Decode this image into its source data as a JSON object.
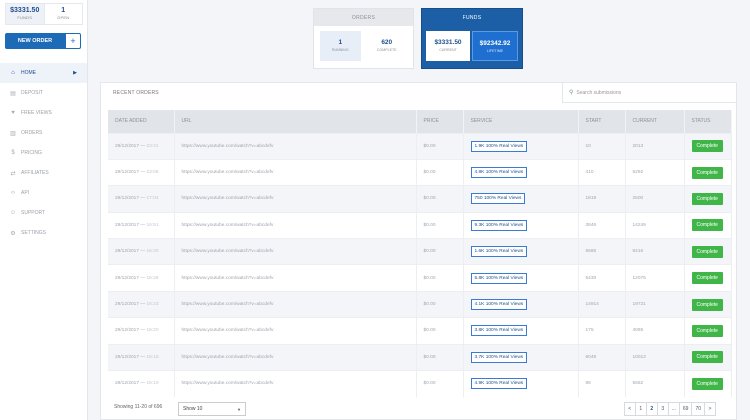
{
  "sidebar": {
    "stats": {
      "funds_value": "$3331.50",
      "funds_label": "FUNDS",
      "open_value": "1",
      "open_label": "OPEN"
    },
    "new_order_label": "NEW ORDER",
    "new_order_plus": "+",
    "items": [
      {
        "label": "HOME",
        "icon": "home-icon"
      },
      {
        "label": "DEPOSIT",
        "icon": "wallet-icon"
      },
      {
        "label": "FREE VIEWS",
        "icon": "heart-icon"
      },
      {
        "label": "ORDERS",
        "icon": "document-icon"
      },
      {
        "label": "PRICING",
        "icon": "dollar-icon"
      },
      {
        "label": "AFFILIATES",
        "icon": "share-icon"
      },
      {
        "label": "API",
        "icon": "code-icon"
      },
      {
        "label": "SUPPORT",
        "icon": "users-icon"
      },
      {
        "label": "SETTINGS",
        "icon": "gear-icon"
      }
    ]
  },
  "orders_card": {
    "title": "ORDERS",
    "running_value": "1",
    "running_label": "RUNNING",
    "complete_value": "620",
    "complete_label": "COMPLETE"
  },
  "funds_card": {
    "title": "FUNDS",
    "current_value": "$3331.50",
    "current_label": "CURRENT",
    "lifetime_value": "$92342.92",
    "lifetime_label": "LIFETIME"
  },
  "recent": {
    "title": "RECENT ORDERS",
    "search_placeholder": "Search submissions",
    "columns": [
      "DATE ADDED",
      "URL",
      "PRICE",
      "SERVICE",
      "START",
      "CURRENT",
      "STATUS"
    ],
    "rows": [
      {
        "date": "29/12/2017",
        "time": "23:41",
        "url": "https://www.youtube.com/watch?v=abcdefv",
        "price": "$0.00",
        "service": "1.9K 100% Real Views",
        "start": "10",
        "current": "2013",
        "status": "Complete"
      },
      {
        "date": "29/12/2017",
        "time": "23:08",
        "url": "https://www.youtube.com/watch?v=abcdefv",
        "price": "$0.00",
        "service": "4.8K 100% Real Views",
        "start": "410",
        "current": "5292",
        "status": "Complete"
      },
      {
        "date": "29/12/2017",
        "time": "17:04",
        "url": "https://www.youtube.com/watch?v=abcdefv",
        "price": "$0.00",
        "service": "750 100% Real Views",
        "start": "1819",
        "current": "2500",
        "status": "Complete"
      },
      {
        "date": "29/12/2017",
        "time": "16:51",
        "url": "https://www.youtube.com/watch?v=abcdefv",
        "price": "$0.00",
        "service": "9.3K 100% Real Views",
        "start": "3846",
        "current": "14249",
        "status": "Complete"
      },
      {
        "date": "29/12/2017",
        "time": "16:30",
        "url": "https://www.youtube.com/watch?v=abcdefv",
        "price": "$0.00",
        "service": "1.6K 100% Real Views",
        "start": "6586",
        "current": "8416",
        "status": "Complete"
      },
      {
        "date": "29/12/2017",
        "time": "16:26",
        "url": "https://www.youtube.com/watch?v=abcdefv",
        "price": "$0.00",
        "service": "5.8K 100% Real Views",
        "start": "5430",
        "current": "12075",
        "status": "Complete"
      },
      {
        "date": "29/12/2017",
        "time": "16:23",
        "url": "https://www.youtube.com/watch?v=abcdefv",
        "price": "$0.00",
        "service": "4.1K 100% Real Views",
        "start": "14914",
        "current": "19721",
        "status": "Complete"
      },
      {
        "date": "29/12/2017",
        "time": "16:20",
        "url": "https://www.youtube.com/watch?v=abcdefv",
        "price": "$0.00",
        "service": "3.8K 100% Real Views",
        "start": "175",
        "current": "4065",
        "status": "Complete"
      },
      {
        "date": "29/12/2017",
        "time": "16:18",
        "url": "https://www.youtube.com/watch?v=abcdefv",
        "price": "$0.00",
        "service": "3.7K 100% Real Views",
        "start": "6049",
        "current": "10013",
        "status": "Complete"
      },
      {
        "date": "28/12/2017",
        "time": "16:19",
        "url": "https://www.youtube.com/watch?v=abcdefv",
        "price": "$0.00",
        "service": "4.9K 100% Real Views",
        "start": "86",
        "current": "5562",
        "status": "Complete"
      }
    ],
    "footer": {
      "showing": "Showing 11-20 of 696",
      "show_select": "Show 10",
      "pages": [
        "<",
        "1",
        "2",
        "3",
        "...",
        "69",
        "70",
        ">"
      ],
      "active_page": "2"
    }
  },
  "colors": {
    "brand_blue": "#1d5fa6",
    "status_green": "#40b649"
  }
}
